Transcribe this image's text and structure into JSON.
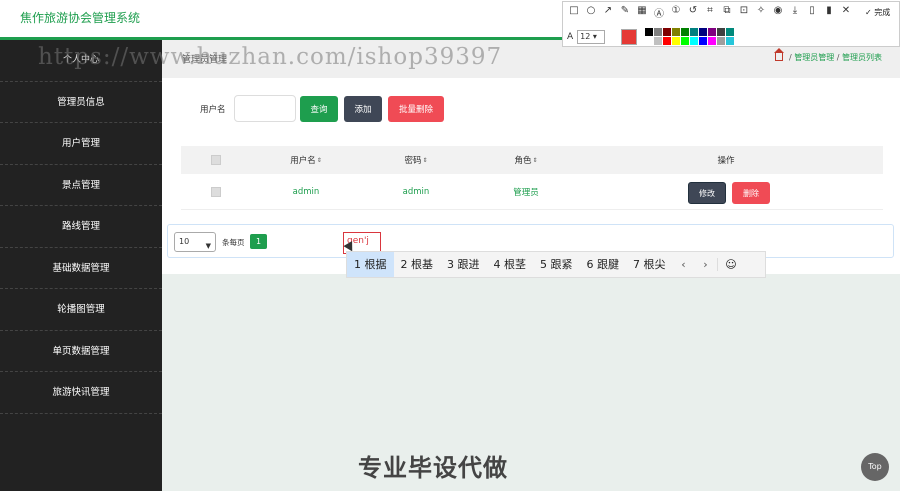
{
  "header": {
    "title": "焦作旅游协会管理系统"
  },
  "sidebar": {
    "top_label": "个人中心",
    "items": [
      {
        "label": "管理员信息"
      },
      {
        "label": "用户管理"
      },
      {
        "label": "景点管理"
      },
      {
        "label": "路线管理"
      },
      {
        "label": "基础数据管理"
      },
      {
        "label": "轮播图管理"
      },
      {
        "label": "单页数据管理"
      },
      {
        "label": "旅游快讯管理"
      }
    ]
  },
  "breadcrumb": {
    "page_title": "管理员管理",
    "sep": "/",
    "items": [
      "管理员管理",
      "管理员列表"
    ]
  },
  "search": {
    "label": "用户名",
    "value": "",
    "query_label": "查询",
    "add_label": "添加",
    "bulk_delete_label": "批量删除"
  },
  "table": {
    "columns": [
      "用户名",
      "密码",
      "角色",
      "操作"
    ],
    "sort_glyph": "⇕",
    "rows": [
      {
        "username": "admin",
        "password": "admin",
        "role": "管理员",
        "edit_label": "修改",
        "delete_label": "删除"
      }
    ]
  },
  "pagination": {
    "page_size": "10",
    "per_page_label": "条每页",
    "current_page": "1"
  },
  "ime": {
    "composing": "gen'j",
    "candidates": [
      "1 根据",
      "2 根基",
      "3 跟进",
      "4 根茎",
      "5 跟紧",
      "6 跟腱",
      "7 根尖"
    ],
    "prev": "‹",
    "next": "›",
    "emoji": "☺"
  },
  "snip_toolbar": {
    "font_size": "12",
    "font_icon": "A",
    "done_label": "完成",
    "current_color": "#e53935",
    "palette": [
      "#000000",
      "#808080",
      "#7f0000",
      "#808000",
      "#008000",
      "#008080",
      "#000080",
      "#800080",
      "#404040",
      "#00897b",
      "#ffffff",
      "#c0c0c0",
      "#ff0000",
      "#ffff00",
      "#00ff00",
      "#00ffff",
      "#0000ff",
      "#ff00ff",
      "#9e9e9e",
      "#26c6da"
    ]
  },
  "overlay": {
    "watermark": "https://www.huzhan.com/ishop39397",
    "bottom_text": "专业毕设代做",
    "top_button": "Top"
  },
  "colors": {
    "accent": "#1e9e4e",
    "danger": "#f04b55",
    "dark": "#3f4756",
    "sidebar": "#222222"
  }
}
